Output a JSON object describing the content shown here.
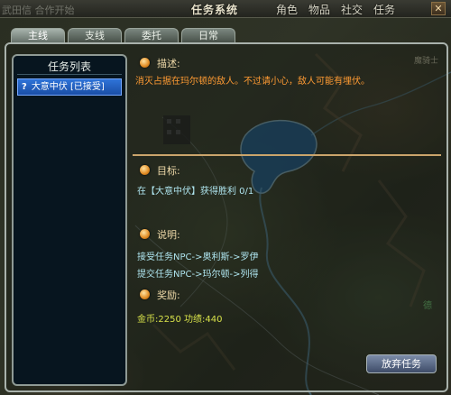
{
  "colors": {
    "panel_border": "#a9b2ac",
    "quest_highlight": "#2e73d8",
    "description_text": "#ff9b33",
    "info_text": "#aee4ee",
    "reward_text": "#d8e24a",
    "section_label": "#eed9a8"
  },
  "hud": {
    "left_text": "武田信 合作开始",
    "blurred_text": "",
    "title": "任务系统",
    "menu": [
      "角色",
      "物品",
      "社交",
      "任务"
    ],
    "close_symbol": "✕"
  },
  "tabs": [
    "主线",
    "支线",
    "委托",
    "日常"
  ],
  "quest_list": {
    "title": "任务列表",
    "items": [
      {
        "icon": "?",
        "text": "大意中伏 [已接受]"
      }
    ]
  },
  "detail": {
    "description_label": "描述:",
    "description_text": "消灭占据在玛尔顿的敌人。不过请小心，敌人可能有埋伏。",
    "objective_label": "目标:",
    "objective_text": "在【大意中伏】获得胜利  0/1",
    "explanation_label": "说明:",
    "explanation_lines": [
      "接受任务NPC->奥利斯->罗伊",
      "提交任务NPC->玛尔顿->列得"
    ],
    "reward_label": "奖励:",
    "reward_text": "金币:2250 功绩:440"
  },
  "abandon_label": "放弃任务",
  "map_labels": [
    "魔骑士",
    "德"
  ]
}
